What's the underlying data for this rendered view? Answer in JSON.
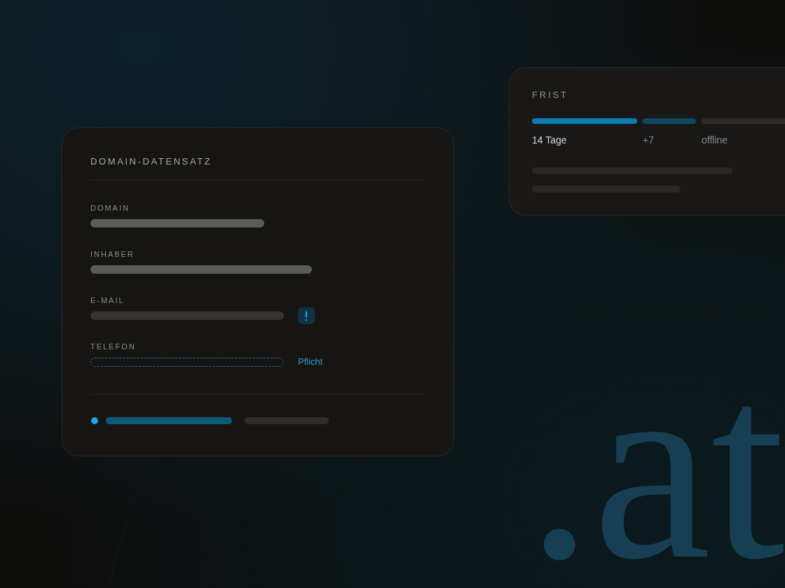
{
  "record_card": {
    "title": "DOMAIN-DATENSATZ",
    "fields": [
      {
        "label": "DOMAIN",
        "kind": "filled"
      },
      {
        "label": "INHABER",
        "kind": "filled"
      },
      {
        "label": "E-MAIL",
        "kind": "warning"
      },
      {
        "label": "TELEFON",
        "kind": "empty",
        "note": "Pflicht"
      }
    ]
  },
  "deadline_card": {
    "title": "FRIST",
    "segments": [
      {
        "label": "14 Tage",
        "kind": "active"
      },
      {
        "label": "+7",
        "kind": "extension"
      },
      {
        "label": "offline",
        "kind": "inactive"
      }
    ]
  },
  "backdrop_text": ".at"
}
